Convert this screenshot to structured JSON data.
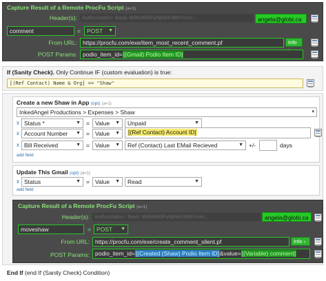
{
  "capture1": {
    "title": "Capture Result of a Remote ProcFu Script",
    "count": "(a=1)",
    "headers_label": "Header(s):",
    "headers_value": "Authorization: Basic M0N4M0FyNjN4X3MtYmxv...",
    "headers_chip": "angela@globi.ca",
    "var_name": "comment",
    "op": "POST",
    "url_label": "From URL:",
    "url": "https://procfu.com/exe/item_most_recent_comment.pf",
    "info": "Info",
    "params_label": "POST Params:",
    "params_prefix": "podio_item_id=",
    "params_token": "[(Gmail) Podio Item ID]"
  },
  "ifblock": {
    "title": "If (Sanity Check).",
    "subtitle": "Only Continue IF (custom evaluation) is true:",
    "expr": "[(Ref Contact) Name & Org] == \"Shaw\""
  },
  "create": {
    "title": "Create a new Shaw in App",
    "opt": "(opt)",
    "count": "(a=1)",
    "app_path": "InkedAngel Productions > Expenses > Shaw",
    "rows": [
      {
        "field": "Status *",
        "op": "Value",
        "value": "Unpaid"
      },
      {
        "field": "Account Number",
        "op": "Value",
        "value": "[(Ref Contact) Account ID]"
      },
      {
        "field": "Bill Received",
        "op": "Value",
        "value": "Ref (Contact) Last EMail Recieved",
        "offset_label": "+/-",
        "days_label": "days"
      }
    ],
    "add_field": "add field"
  },
  "update": {
    "title": "Update This Gmail",
    "opt": "(opt)",
    "count": "(a=1)",
    "rows": [
      {
        "field": "Status",
        "op": "Value",
        "value": "Read"
      }
    ],
    "add_field": "add field"
  },
  "capture2": {
    "title": "Capture Result of a Remote ProcFu Script",
    "count": "(a=1)",
    "headers_label": "Header(s):",
    "headers_value": "Authorization: Basic M0N4M0FyNjN4X3MtYmxv...",
    "headers_chip": "angela@globi.ca",
    "var_name": "moveshaw",
    "op": "POST",
    "url_label": "From URL:",
    "url": "https://procfu.com/exe/create_comment_silent.pf",
    "info": "Info",
    "params_label": "POST Params:",
    "params_prefix": "podio_item_id=",
    "params_token": "[(Created (Shaw) Podio Item ID]",
    "params_mid": "&value=",
    "params_token2": "[(Variable) comment]"
  },
  "endif": {
    "label": "End If",
    "sub": "(end If (Sanity Check) Condition)"
  }
}
